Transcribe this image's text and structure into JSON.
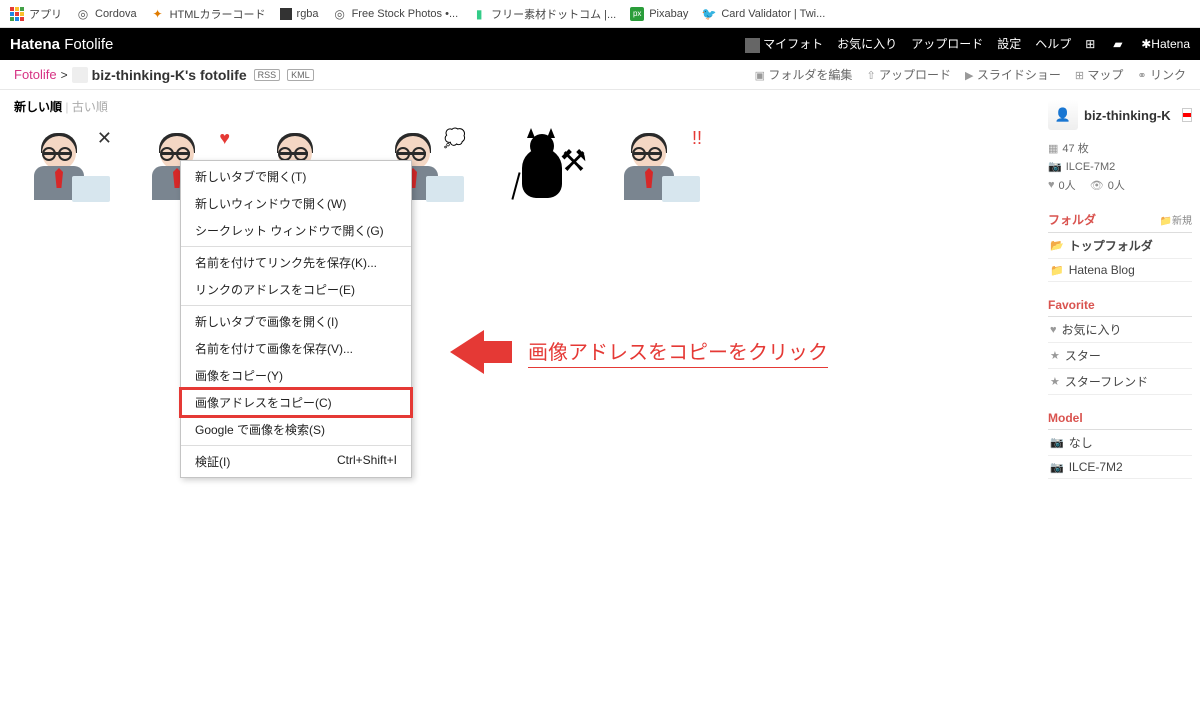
{
  "bookmarks": [
    {
      "label": "アプリ",
      "color": ""
    },
    {
      "label": "Cordova",
      "color": "#555"
    },
    {
      "label": "HTMLカラーコード",
      "color": "#e07b00"
    },
    {
      "label": "rgba",
      "color": "#333"
    },
    {
      "label": "Free Stock Photos •...",
      "color": "#555"
    },
    {
      "label": "フリー素材ドットコム |...",
      "color": "#3c8"
    },
    {
      "label": "Pixabay",
      "color": "#2a9d3a"
    },
    {
      "label": "Card Validator | Twi...",
      "color": "#1da1f2"
    }
  ],
  "site_logo": {
    "a": "Hatena",
    "b": "Fotolife"
  },
  "topnav": {
    "myphoto": "マイフォト",
    "fav": "お気に入り",
    "upload": "アップロード",
    "settings": "設定",
    "help": "ヘルプ",
    "brand": "Hatena"
  },
  "breadcrumb": {
    "root": "Fotolife",
    "sep": ">",
    "title": "biz-thinking-K's fotolife",
    "badges": [
      "RSS",
      "KML"
    ]
  },
  "toolbar": {
    "edit": "フォルダを編集",
    "upload": "アップロード",
    "slideshow": "スライドショー",
    "map": "マップ",
    "link": "リンク"
  },
  "sort": {
    "new": "新しい順",
    "old": "古い順",
    "sep": "|"
  },
  "thumbs": [
    {
      "kind": "person",
      "mark": "✕",
      "mc": "#333"
    },
    {
      "kind": "person",
      "mark": "♥",
      "mc": "#e53935"
    },
    {
      "kind": "person",
      "mark": "",
      "mc": ""
    },
    {
      "kind": "person",
      "mark": "💭",
      "mc": "#6cf"
    },
    {
      "kind": "devil"
    },
    {
      "kind": "person",
      "mark": "!!",
      "mc": "#e53935"
    }
  ],
  "ctx": [
    "新しいタブで開く(T)",
    "新しいウィンドウで開く(W)",
    "シークレット ウィンドウで開く(G)",
    "-",
    "名前を付けてリンク先を保存(K)...",
    "リンクのアドレスをコピー(E)",
    "-",
    "新しいタブで画像を開く(I)",
    "名前を付けて画像を保存(V)...",
    "画像をコピー(Y)",
    "画像アドレスをコピー(C)",
    "Google で画像を検索(S)",
    "-",
    "検証(I)"
  ],
  "ctx_shortcut": "Ctrl+Shift+I",
  "ctx_highlight_index": 10,
  "annotation": "画像アドレスをコピーをクリック",
  "sidebar": {
    "user": "biz-thinking-K",
    "count": "47 枚",
    "camera": "ILCE-7M2",
    "likes": "0人",
    "views": "0人",
    "folders_title": "フォルダ",
    "folders_new": "新規",
    "folders": [
      "トップフォルダ",
      "Hatena Blog"
    ],
    "fav_title": "Favorite",
    "fav_items": [
      {
        "ic": "♥",
        "t": "お気に入り"
      },
      {
        "ic": "★",
        "t": "スター"
      },
      {
        "ic": "★",
        "t": "スターフレンド"
      }
    ],
    "model_title": "Model",
    "model_items": [
      "なし",
      "ILCE-7M2"
    ]
  }
}
